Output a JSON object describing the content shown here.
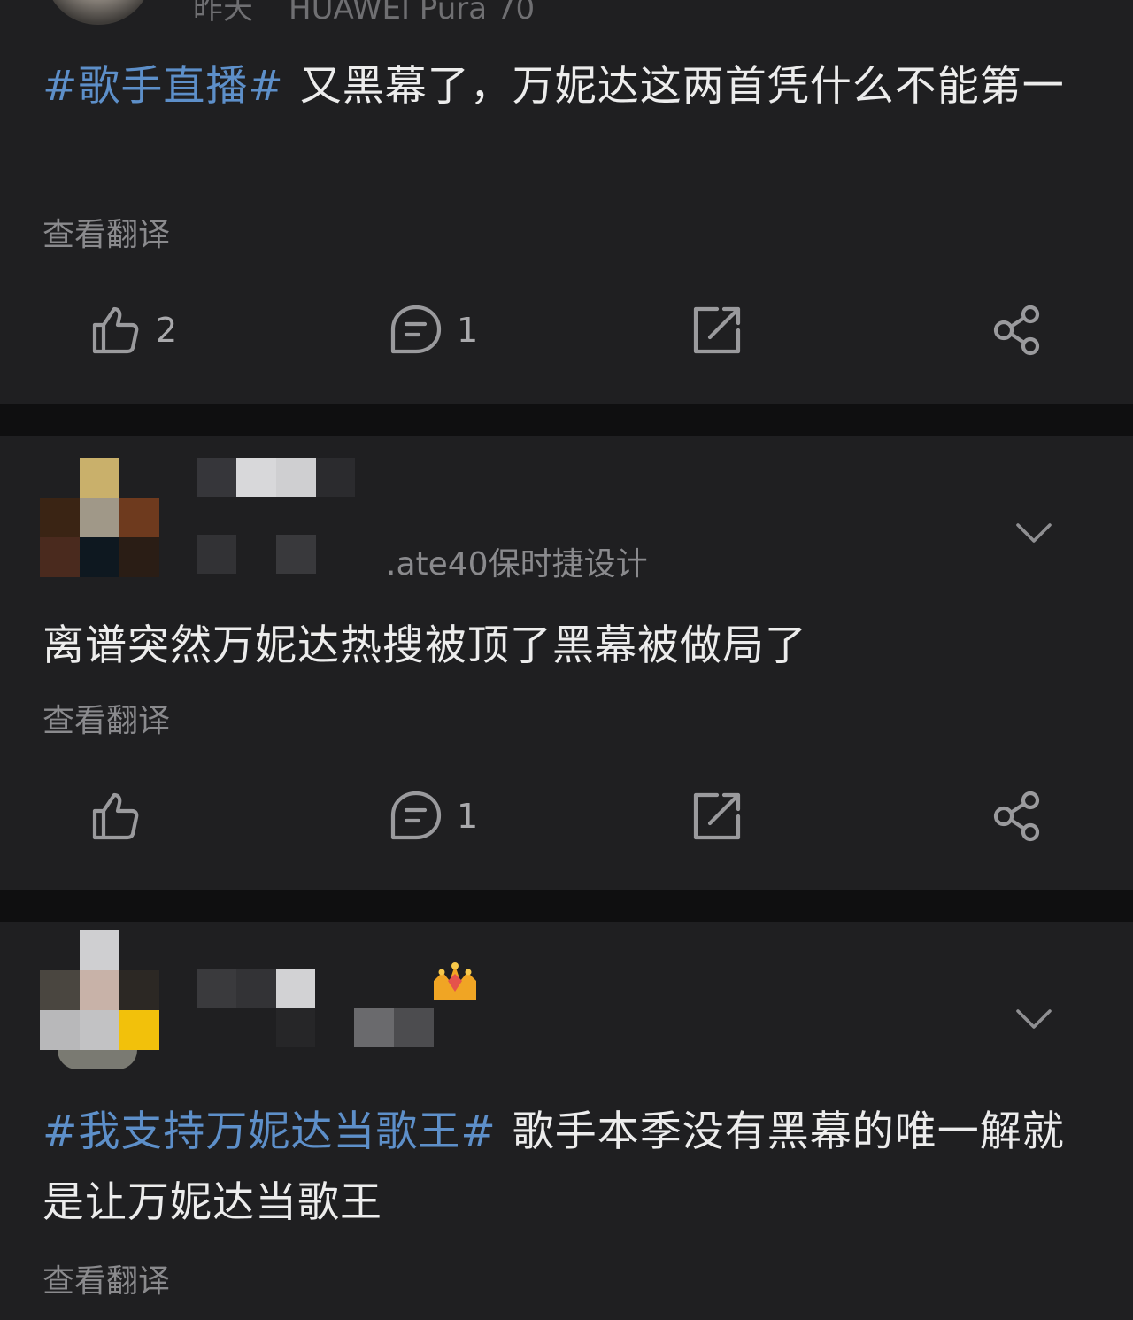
{
  "post1": {
    "time": "昨天",
    "device": "HUAWEI Pura 70",
    "hashtag": "#歌手直播#",
    "text": "又黑幕了，万妮达这两首凭什么不能第一",
    "translate": "查看翻译",
    "actions": {
      "like_count": "2",
      "comment_count": "1"
    }
  },
  "post2": {
    "device_suffix": ".ate40保时捷设计",
    "text": "离谱突然万妮达热搜被顶了黑幕被做局了",
    "translate": "查看翻译",
    "actions": {
      "like_count": "",
      "comment_count": "1"
    }
  },
  "post3": {
    "hashtag": "#我支持万妮达当歌王#",
    "text": "歌手本季没有黑幕的唯一解就是让万妮达当歌王",
    "translate": "查看翻译"
  },
  "icons": [
    "like-icon",
    "comment-icon",
    "repost-icon",
    "share-icon",
    "chevron-down-icon",
    "crown-icon"
  ],
  "colors": {
    "background": "#0f0f10",
    "card": "#1f1f21",
    "hashtag": "#5d8fc9",
    "muted": "#8a8a8d"
  }
}
